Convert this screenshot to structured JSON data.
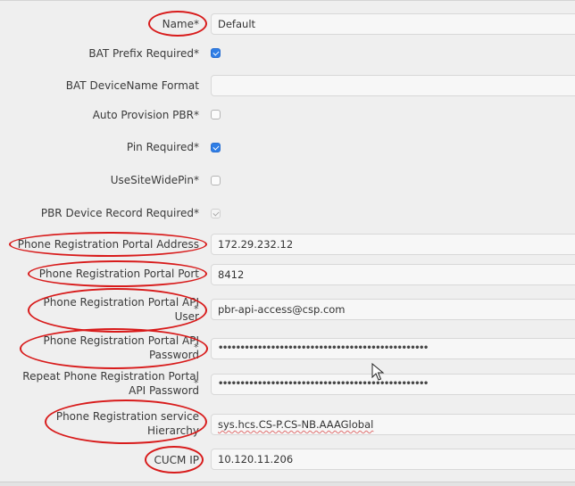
{
  "form": {
    "name": {
      "label": "Name*",
      "value": "Default"
    },
    "bat_prefix_required": {
      "label": "BAT Prefix Required*",
      "checked": true
    },
    "bat_devicename_format": {
      "label": "BAT DeviceName Format",
      "value": ""
    },
    "auto_provision_pbr": {
      "label": "Auto Provision PBR*",
      "checked": false
    },
    "pin_required": {
      "label": "Pin Required*",
      "checked": true
    },
    "use_site_wide_pin": {
      "label": "UseSiteWidePin*",
      "checked": false
    },
    "pbr_device_record_required": {
      "label": "PBR Device Record Required*",
      "checked": true,
      "disabled": true
    },
    "portal_address": {
      "label": "Phone Registration Portal Address",
      "value": "172.29.232.12"
    },
    "portal_port": {
      "label": "Phone Registration Portal Port",
      "value": "8412"
    },
    "api_user": {
      "label_line1": "Phone Registration Portal API",
      "label_line2": "User",
      "required_mark": "*",
      "value": "pbr-api-access@csp.com"
    },
    "api_password": {
      "label_line1": "Phone Registration Portal API",
      "label_line2": "Password",
      "required_mark": "*",
      "value": "••••••••••••••••••••••••••••••••••••••••••••••••"
    },
    "repeat_api_password": {
      "label_line1": "Repeat Phone Registration Portal",
      "label_line2": "API Password",
      "required_mark": "*",
      "value": "••••••••••••••••••••••••••••••••••••••••••••••••"
    },
    "service_hierarchy": {
      "label_line1": "Phone Registration service",
      "label_line2": "Hierarchy",
      "value": "sys.hcs.CS-P.CS-NB.AAAGlobal"
    },
    "cucm_ip": {
      "label": "CUCM IP",
      "value": "10.120.11.206"
    }
  },
  "annotations": {
    "highlight_color": "#d81b1b",
    "highlighted_fields": [
      "Name",
      "Phone Registration Portal Address",
      "Phone Registration Portal Port",
      "Phone Registration Portal API User",
      "Phone Registration Portal API Password",
      "Phone Registration service Hierarchy",
      "CUCM IP"
    ]
  },
  "colors": {
    "checkbox_checked": "#2f7ee6",
    "background": "#efefef"
  }
}
